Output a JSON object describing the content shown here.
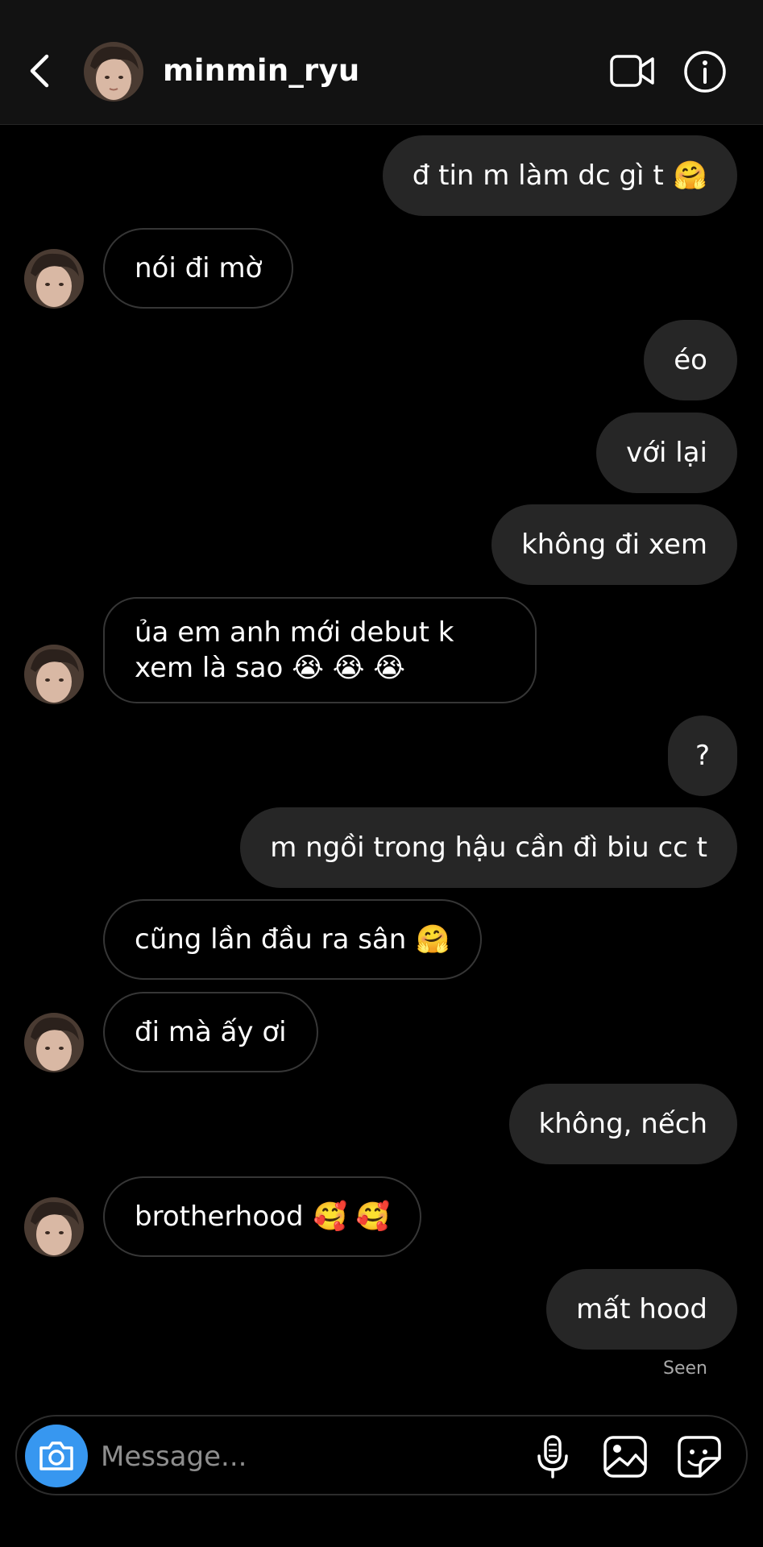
{
  "header": {
    "username": "minmin_ryu",
    "back_icon": "chevron-left-icon",
    "video_icon": "video-camera-icon",
    "info_icon": "info-icon"
  },
  "messages": [
    {
      "side": "out",
      "text": "đ tin m làm dc gì t",
      "emoji": "🤗"
    },
    {
      "side": "in",
      "text": "nói đi mờ"
    },
    {
      "side": "out",
      "text": "éo"
    },
    {
      "side": "out",
      "text": "với lại"
    },
    {
      "side": "out",
      "text": "không đi xem"
    },
    {
      "side": "in",
      "text": "ủa em anh mới debut k xem là sao",
      "emoji": "😭 😭 😭"
    },
    {
      "side": "out",
      "text": "?"
    },
    {
      "side": "out",
      "text": "m ngồi trong hậu cần đì biu cc t"
    },
    {
      "side": "in",
      "text": "cũng lần đầu ra sân",
      "emoji": "🤗"
    },
    {
      "side": "in",
      "text": "đi mà ấy ơi"
    },
    {
      "side": "out",
      "text": "không, nếch"
    },
    {
      "side": "in",
      "text": "brotherhood",
      "emoji": "🥰 🥰"
    },
    {
      "side": "out",
      "text": "mất hood"
    }
  ],
  "status": {
    "seen": "Seen"
  },
  "composer": {
    "placeholder": "Message...",
    "accent_color": "#3797f0"
  }
}
